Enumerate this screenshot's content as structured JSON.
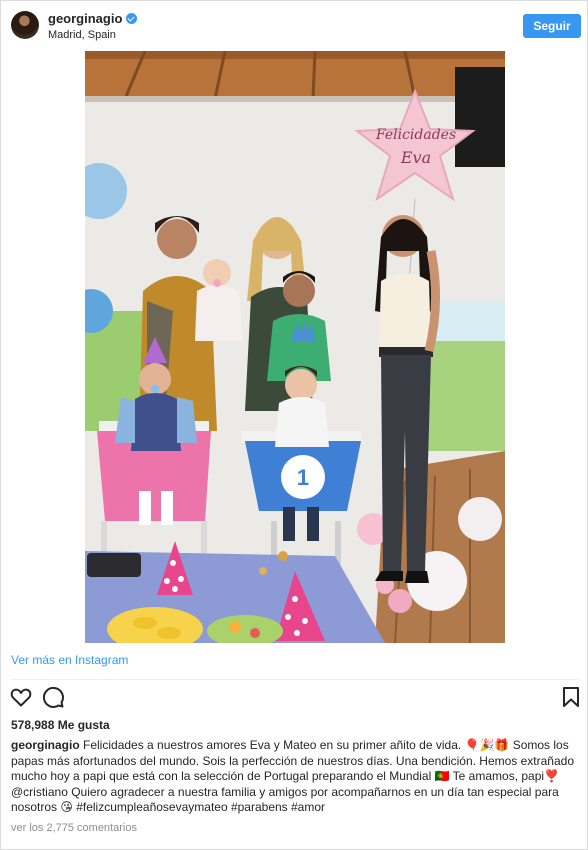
{
  "post": {
    "username": "georginagio",
    "location": "Madrid, Spain",
    "follow_label": "Seguir",
    "more_link": "Ver más en Instagram",
    "likes": "578,988 Me gusta",
    "caption_username": "georginagio",
    "caption_text": "Felicidades a nuestros amores Eva y Mateo en su primer añito de vida. 🎈🎉🎁 Somos los papas más afortunados del mundo. Sois la perfección de nuestros días. Una bendición. Hemos extrañado mucho hoy a papi que está con la selección de Portugal preparando el Mundial 🇵🇹 Te amamos, papi❣️ @cristiano Quiero agradecer a nuestra familia y amigos por acompañarnos en un día tan especial para nosotros 😘 #felizcumpleañosevaymateo #parabens #amor",
    "comments_link": "ver los 2,775 comentarios"
  },
  "photo": {
    "balloon_text_line1": "Felicidades",
    "balloon_text_line2": "Eva",
    "highchair_number": "1"
  },
  "icons": {
    "like": "heart-icon",
    "comment": "comment-icon",
    "save": "bookmark-icon",
    "verified": "verified-badge-icon"
  },
  "colors": {
    "accent": "#3897f0",
    "text": "#262626",
    "muted": "#8e8e8e",
    "border": "#dbdbdb"
  }
}
